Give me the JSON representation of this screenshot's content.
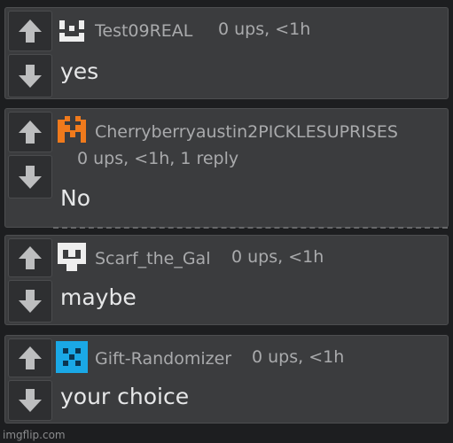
{
  "comments": [
    {
      "username": "Test09REAL",
      "meta": "0 ups, <1h",
      "text": "yes",
      "avatar": "white-face-pixel-avatar"
    },
    {
      "username": "Cherryberryaustin2PICKLESUPRISES",
      "meta": "0 ups, <1h, 1 reply",
      "text": "No",
      "avatar": "orange-pixel-avatar"
    },
    {
      "username": "Scarf_the_Gal",
      "meta": "0 ups, <1h",
      "text": "maybe",
      "avatar": "white-robot-pixel-avatar"
    },
    {
      "username": "Gift-Randomizer",
      "meta": "0 ups, <1h",
      "text": "your choice",
      "avatar": "cyan-pixel-avatar"
    }
  ],
  "watermark": "imgflip.com",
  "colors": {
    "background": "#1d1e20",
    "card": "#3b3c3e",
    "username": "#a9aaac",
    "text": "#e6e7e8",
    "avatar_orange": "#f07a1c",
    "avatar_cyan": "#1aa8e6"
  }
}
